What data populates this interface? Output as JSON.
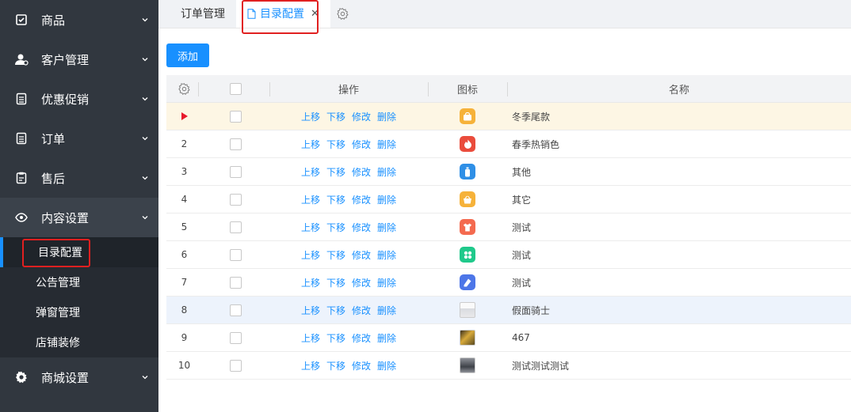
{
  "sidebar": {
    "items": [
      {
        "label": "商品",
        "icon": "checklist-icon"
      },
      {
        "label": "客户管理",
        "icon": "user-icon"
      },
      {
        "label": "优惠促销",
        "icon": "document-icon"
      },
      {
        "label": "订单",
        "icon": "document-icon"
      },
      {
        "label": "售后",
        "icon": "clipboard-icon"
      },
      {
        "label": "内容设置",
        "icon": "eye-icon"
      },
      {
        "label": "商城设置",
        "icon": "gear-icon"
      }
    ],
    "content_submenu": [
      "目录配置",
      "公告管理",
      "弹窗管理",
      "店铺装修"
    ]
  },
  "tabs": [
    {
      "label": "订单管理"
    },
    {
      "label": "目录配置"
    }
  ],
  "toolbar": {
    "add_label": "添加"
  },
  "table": {
    "headers": {
      "op": "操作",
      "icon": "图标",
      "name": "名称"
    },
    "op_labels": [
      "上移",
      "下移",
      "修改",
      "删除"
    ],
    "rows": [
      {
        "idx": "",
        "name": "冬季尾款",
        "icon": "bag-icon",
        "color": "#f6b23a"
      },
      {
        "idx": "2",
        "name": "春季热销色",
        "icon": "fire-icon",
        "color": "#ea4c3c"
      },
      {
        "idx": "3",
        "name": "其他",
        "icon": "bottle-icon",
        "color": "#2f8fe6"
      },
      {
        "idx": "4",
        "name": "其它",
        "icon": "basket-icon",
        "color": "#f6b23a"
      },
      {
        "idx": "5",
        "name": "测试",
        "icon": "shirt-icon",
        "color": "#f46a4f"
      },
      {
        "idx": "6",
        "name": "测试",
        "icon": "grid-icon",
        "color": "#1fc98b"
      },
      {
        "idx": "7",
        "name": "测试",
        "icon": "shoe-icon",
        "color": "#4d76e8"
      },
      {
        "idx": "8",
        "name": "假面骑士",
        "icon": "photo-thumb",
        "color": "#dcdcdc"
      },
      {
        "idx": "9",
        "name": "467",
        "icon": "photo-thumb",
        "color": "#b8962e"
      },
      {
        "idx": "10",
        "name": "测试测试测试",
        "icon": "photo-thumb",
        "color": "#6d6f73"
      }
    ]
  },
  "colors": {
    "accent": "#1890ff",
    "sidebar_bg": "#31373f",
    "highlight": "#e12020"
  }
}
